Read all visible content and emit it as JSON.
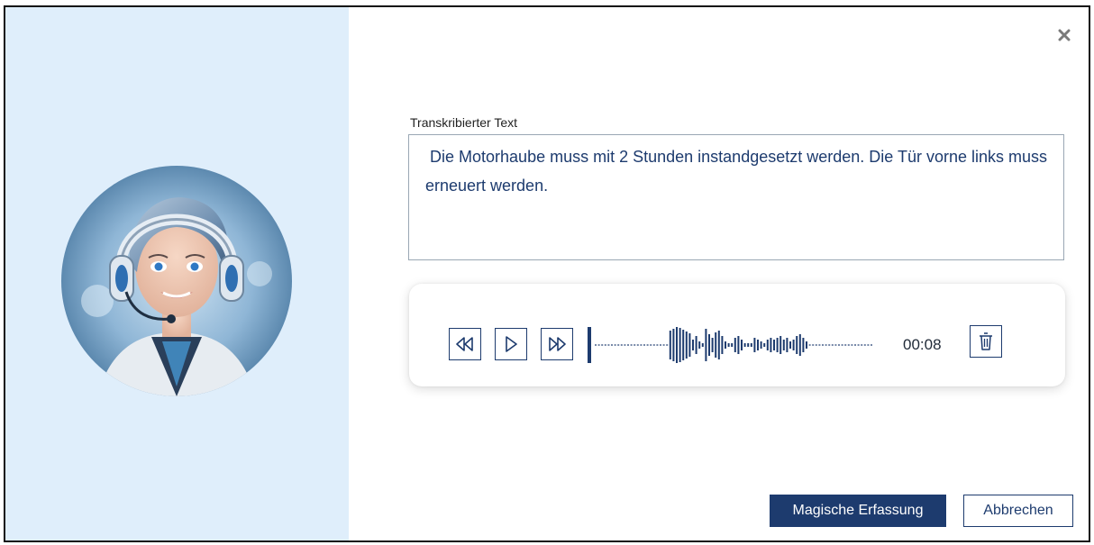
{
  "dialog": {
    "close_icon": "close-icon",
    "avatar_icon": "headset-assistant-avatar"
  },
  "transcript": {
    "label": "Transkribierter Text",
    "value": " Die Motorhaube muss mit 2 Stunden instandgesetzt werden. Die Tür vorne links muss erneuert werden."
  },
  "player": {
    "time": "00:08",
    "rewind_icon": "rewind-icon",
    "play_icon": "play-icon",
    "forward_icon": "fast-forward-icon",
    "delete_icon": "trash-icon",
    "progress": 0.0
  },
  "actions": {
    "primary_label": "Magische Erfassung",
    "cancel_label": "Abbrechen"
  },
  "colors": {
    "accent": "#1d3b6e",
    "left_panel": "#dfeefb",
    "text": "#1d3b6e"
  }
}
